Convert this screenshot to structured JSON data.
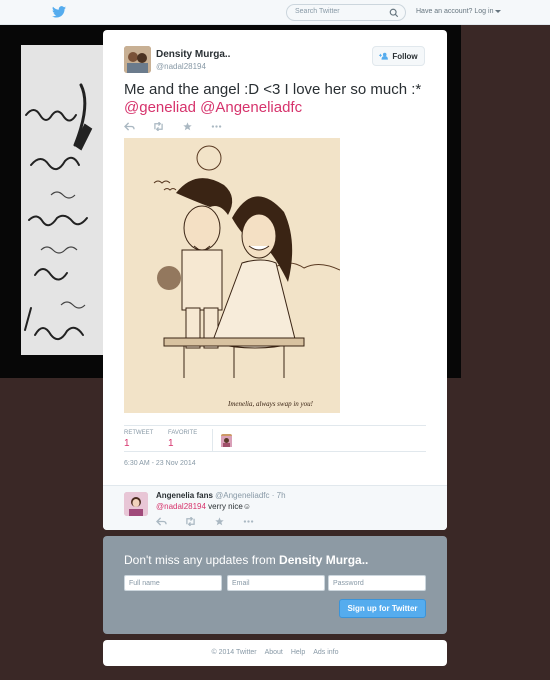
{
  "nav": {
    "search_placeholder": "Search Twitter",
    "have_account": "Have an account?",
    "login": "Log in"
  },
  "tweet": {
    "author_name": "Density Murga..",
    "author_handle": "@nadal28194",
    "follow_label": "Follow",
    "text_prefix": "Me and the angel :D <3 I love her so much :* ",
    "mention1": "@geneliad",
    "mention2": "@Angeneliadfc",
    "photo_caption": "Imenelia, always swap in you!",
    "retweet_label": "RETWEET",
    "retweet_count": "1",
    "favorite_label": "FAVORITE",
    "favorite_count": "1",
    "timestamp": "6:30 AM - 23 Nov 2014"
  },
  "reply": {
    "author_name": "Angenelia fans",
    "author_handle": "@Angeneliadfc · 7h",
    "mention": "@nadal28194",
    "text": " verry nice☺"
  },
  "signup": {
    "title_prefix": "Don't miss any updates from ",
    "title_name": "Density Murga..",
    "full_name_placeholder": "Full name",
    "email_placeholder": "Email",
    "password_placeholder": "Password",
    "button_label": "Sign up for Twitter"
  },
  "footer": {
    "copyright": "© 2014 Twitter",
    "about": "About",
    "help": "Help",
    "ads": "Ads info"
  },
  "colors": {
    "accent": "#55acee",
    "mention": "#d6336c",
    "page_bg": "#3a2826"
  }
}
